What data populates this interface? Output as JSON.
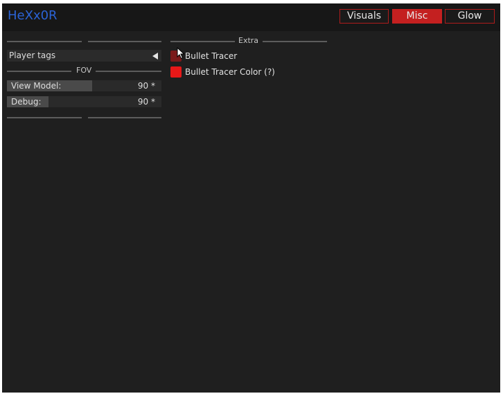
{
  "app": {
    "title": "HeXx0R"
  },
  "tabs": [
    {
      "label": "Visuals",
      "active": false
    },
    {
      "label": "Misc",
      "active": true
    },
    {
      "label": "Glow",
      "active": false
    }
  ],
  "left_panel": {
    "player_tags": {
      "label": "Player tags"
    },
    "fov_section": "FOV",
    "sliders": [
      {
        "label": "View Model:",
        "value": "90 *",
        "fill_fraction": 0.55
      },
      {
        "label": "Debug:",
        "value": "90 *",
        "fill_fraction": 0.27
      }
    ]
  },
  "right_panel": {
    "section": "Extra",
    "bullet_tracer": {
      "label": "Bullet Tracer",
      "checked": false
    },
    "bullet_tracer_color": {
      "label": "Bullet Tracer Color (?)",
      "color": "#e81818"
    }
  },
  "colors": {
    "accent": "#c42020",
    "title": "#2b63d6",
    "background": "#1f1f1f"
  }
}
